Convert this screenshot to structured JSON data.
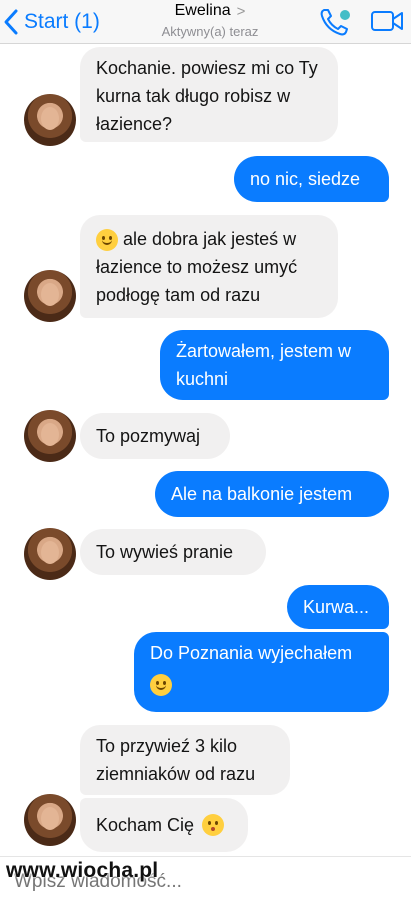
{
  "header": {
    "back_label": "Start (1)",
    "contact_name": "Ewelina",
    "contact_status": "Aktywny(a) teraz"
  },
  "messages": [
    {
      "from": "contact",
      "text": "Kochanie. powiesz mi co Ty kurna tak długo robisz w łazience?"
    },
    {
      "from": "me",
      "text": "no nic, siedze"
    },
    {
      "from": "contact",
      "text": "ale dobra jak jesteś w łazience to możesz umyć podłogę tam od razu",
      "emoji": "slightly-smiling-face"
    },
    {
      "from": "me",
      "text": "Żartowałem, jestem w kuchni"
    },
    {
      "from": "contact",
      "text": "To pozmywaj"
    },
    {
      "from": "me",
      "text": "Ale na balkonie jestem"
    },
    {
      "from": "contact",
      "text": "To wywieś pranie"
    },
    {
      "from": "me",
      "text": "Kurwa..."
    },
    {
      "from": "me",
      "text": "Do Poznania wyjechałem",
      "emoji": "slightly-smiling-face"
    },
    {
      "from": "contact",
      "text": "To przywieź 3 kilo ziemniaków od razu"
    },
    {
      "from": "contact",
      "text": "Kocham Cię",
      "emoji": "kissing-face"
    }
  ],
  "composer": {
    "placeholder": "Wpisz wiadomość..."
  },
  "watermark": "www.wiocha.pl",
  "colors": {
    "accent": "#0a7cff",
    "incoming_bubble": "#f1f0f0",
    "online": "#44bec7"
  }
}
